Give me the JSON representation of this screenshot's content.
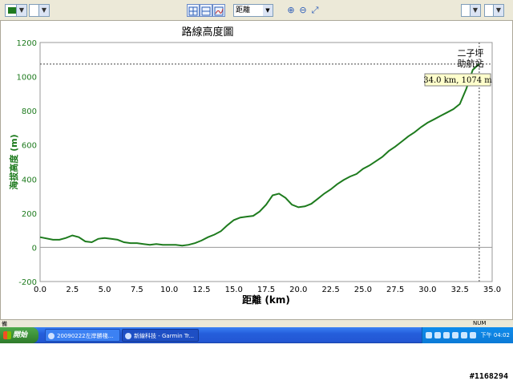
{
  "toolbar": {
    "distance_select": "距離",
    "color_swatch": "#1f7a1f"
  },
  "chart_data": {
    "type": "line",
    "title": "路線高度圖",
    "xlabel": "距離 (km)",
    "ylabel": "海拔高度 (m)",
    "xlim": [
      0,
      35
    ],
    "ylim": [
      -200,
      1200
    ],
    "xticks": [
      "0.0",
      "2.5",
      "5.0",
      "7.5",
      "10.0",
      "12.5",
      "15.0",
      "17.5",
      "20.0",
      "22.5",
      "25.0",
      "27.5",
      "30.0",
      "32.5",
      "35.0"
    ],
    "yticks": [
      "-200",
      "0",
      "200",
      "400",
      "600",
      "800",
      "1000",
      "1200"
    ],
    "grid": true,
    "line_color": "#1e7b1e",
    "series": [
      {
        "x": [
          0,
          1,
          1.5,
          2,
          2.5,
          3,
          3.5,
          4,
          4.5,
          5,
          5.5,
          6,
          6.5,
          7,
          7.5,
          8,
          8.5,
          9,
          9.5,
          10,
          10.5,
          11,
          11.5,
          12,
          12.5,
          13,
          13.5,
          14,
          14.5,
          15,
          15.5,
          16,
          16.5,
          17,
          17.5,
          18,
          18.5,
          19,
          19.5,
          20,
          20.5,
          21,
          21.5,
          22,
          22.5,
          23,
          23.5,
          24,
          24.5,
          25,
          25.5,
          26,
          26.5,
          27,
          27.5,
          28,
          28.5,
          29,
          29.5,
          30,
          30.5,
          31,
          31.5,
          32,
          32.5,
          33,
          33.5,
          34
        ],
        "y": [
          60,
          45,
          45,
          55,
          70,
          60,
          35,
          30,
          50,
          55,
          50,
          45,
          30,
          25,
          25,
          20,
          15,
          20,
          15,
          15,
          15,
          10,
          15,
          25,
          40,
          60,
          75,
          95,
          130,
          160,
          175,
          180,
          185,
          210,
          250,
          305,
          315,
          290,
          250,
          235,
          240,
          255,
          285,
          315,
          340,
          370,
          395,
          415,
          430,
          460,
          480,
          505,
          530,
          565,
          590,
          620,
          650,
          675,
          705,
          730,
          750,
          770,
          790,
          810,
          840,
          930,
          1040,
          1074
        ]
      }
    ],
    "annotations": {
      "marker_line": "二子坪 助航站",
      "marker_label_1": "二子坪",
      "marker_label_2": "助航站",
      "tooltip": "34.0 km, 1074 m",
      "crosshair_x": 34.0,
      "crosshair_y": 1074
    }
  },
  "status": {
    "left": "備",
    "num": "NUM"
  },
  "taskbar": {
    "start": "開始",
    "task1": "20090222左岸勝棧...",
    "task2": "新線科技 - Garmin Tr...",
    "clock": "下午 04:02"
  },
  "watermark": "#1168294"
}
